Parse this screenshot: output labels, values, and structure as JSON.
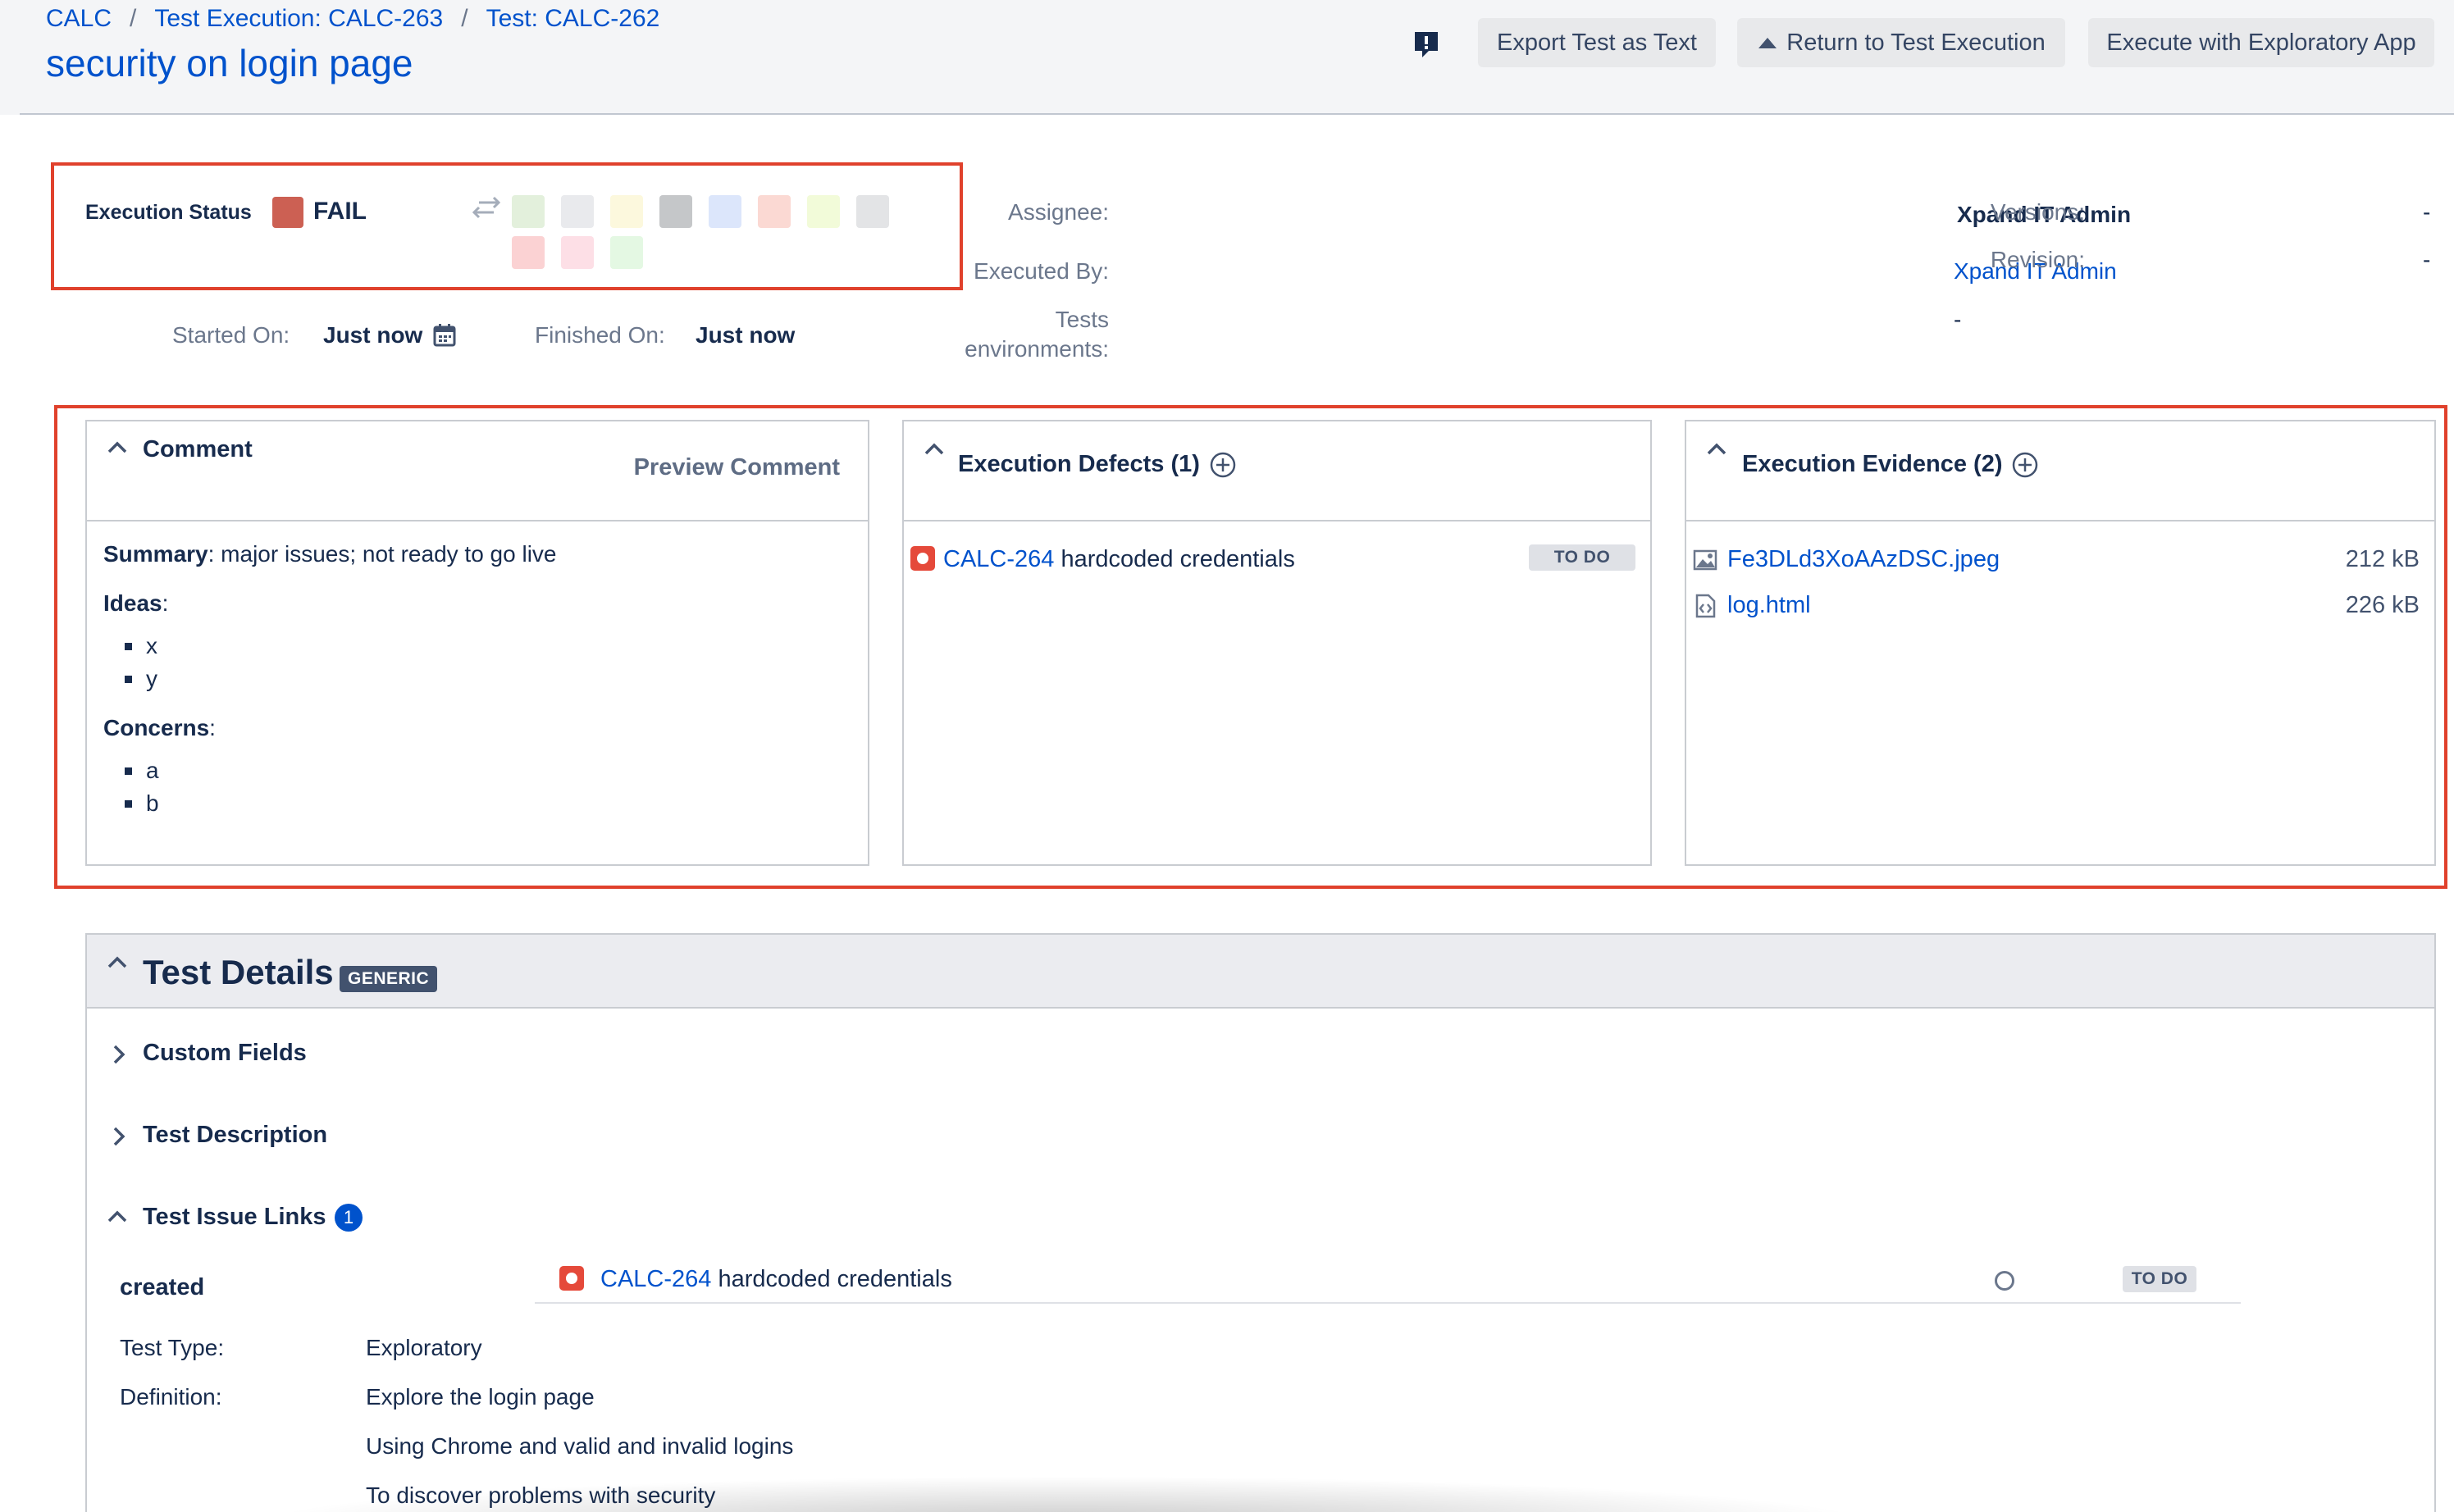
{
  "breadcrumb": [
    "CALC",
    "Test Execution: CALC-263",
    "Test: CALC-262"
  ],
  "page_title": "security on login page",
  "header_buttons": {
    "export": "Export Test as Text",
    "return": "Return to Test Execution",
    "explore": "Execute with Exploratory App"
  },
  "execution_status": {
    "label": "Execution Status",
    "value": "FAIL",
    "color": "#cc6053",
    "other_status_colors": [
      "#e3f0dc",
      "#e9eaed",
      "#fcf8dd",
      "#c5c7c9",
      "#dce6fb",
      "#fbd9d3",
      "#f2fbd9",
      "#e3e4e6",
      "#fbd2d3",
      "#fddfe6",
      "#e4f8e3"
    ]
  },
  "timing": {
    "started_label": "Started On:",
    "started_value": "Just now",
    "finished_label": "Finished On:",
    "finished_value": "Just now"
  },
  "people": {
    "assignee_label": "Assignee:",
    "assignee_value": "Xpand IT Admin",
    "executed_by_label": "Executed By:",
    "executed_by_value": "Xpand IT Admin",
    "tests_env_label_1": "Tests",
    "tests_env_label_2": "environments:",
    "tests_env_value": "-",
    "versions_label": "Versions:",
    "versions_value": "-",
    "revision_label": "Revision:",
    "revision_value": "-"
  },
  "comment_panel": {
    "title": "Comment",
    "preview": "Preview Comment",
    "summary_label": "Summary",
    "summary_text": ": major issues; not ready to go live",
    "ideas_label": "Ideas",
    "ideas_colon": ":",
    "ideas": [
      "x",
      "y"
    ],
    "concerns_label": "Concerns",
    "concerns_colon": ":",
    "concerns": [
      "a",
      "b"
    ]
  },
  "defects_panel": {
    "title": "Execution Defects (1)",
    "issue_key": "CALC-264",
    "issue_summary": "hardcoded credentials",
    "status": "TO DO"
  },
  "evidence_panel": {
    "title": "Execution Evidence (2)",
    "files": [
      {
        "name": "Fe3DLd3XoAAzDSC.jpeg",
        "size": "212 kB",
        "icon": "image-file-icon"
      },
      {
        "name": "log.html",
        "size": "226 kB",
        "icon": "code-file-icon"
      }
    ]
  },
  "test_details": {
    "title": "Test Details",
    "badge": "GENERIC",
    "custom_fields": "Custom Fields",
    "test_description": "Test Description",
    "issue_links": "Test Issue Links",
    "issue_links_count": "1",
    "link_type": "created",
    "linked_issue_key": "CALC-264",
    "linked_issue_summary": "hardcoded credentials",
    "linked_issue_status": "TO DO",
    "test_type_label": "Test Type:",
    "test_type_value": "Exploratory",
    "definition_label": "Definition:",
    "definition_lines": [
      "Explore the login page",
      "Using Chrome and valid and invalid logins",
      "To discover problems with security"
    ]
  }
}
